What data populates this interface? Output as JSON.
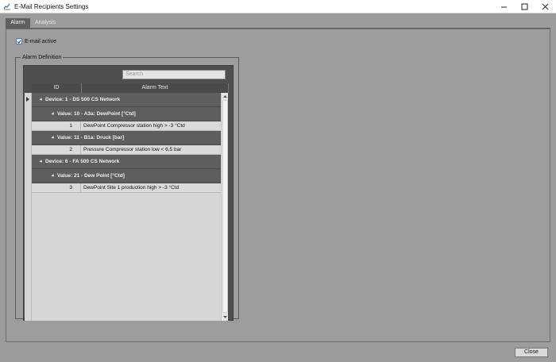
{
  "window": {
    "title": "E-Mail Recipients Settings"
  },
  "tabs": [
    {
      "label": "Alarm"
    },
    {
      "label": "Analysis"
    }
  ],
  "email_active": {
    "label": "E-mail active",
    "checked": true
  },
  "alarm_definition": {
    "title": "Alarm Definition",
    "search": {
      "placeholder": "Search"
    },
    "columns": {
      "id": "ID",
      "text": "Alarm Text"
    },
    "groups": [
      {
        "device": "Device: 1 - DS 500 CS Network",
        "values": [
          {
            "value": "Value: 10 - A3a: DewPoint [°Ctd]",
            "rows": [
              {
                "id": "1",
                "text": "DewPoint Compressor station high > -3 °Ctd"
              }
            ]
          },
          {
            "value": "Value: 11 - B1a: Druck [bar]",
            "rows": [
              {
                "id": "2",
                "text": "Pressure Compressor station low < 6,5 bar"
              }
            ]
          }
        ]
      },
      {
        "device": "Device: 6 - FA 500 CS Network",
        "values": [
          {
            "value": "Value: 21 - Dew Point [°Ctd]",
            "rows": [
              {
                "id": "3",
                "text": "DewPoint Site 1 production high > -3 °Ctd"
              }
            ]
          }
        ]
      }
    ]
  },
  "footer": {
    "close_label": "Close"
  }
}
